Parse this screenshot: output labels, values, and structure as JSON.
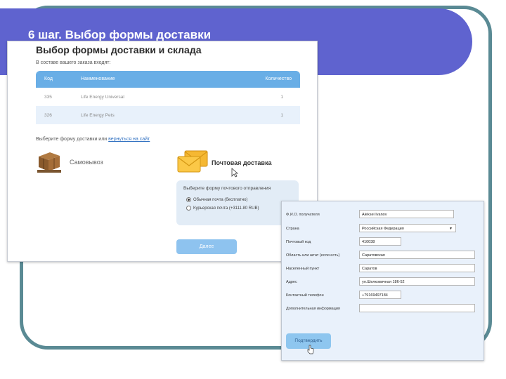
{
  "slide": {
    "title": "6 шаг. Выбор формы доставки",
    "colors": {
      "header": "#5f63cf",
      "frame": "#5a8a94"
    }
  },
  "shipping_page": {
    "title": "Выбор формы доставки и склада",
    "order_note": "В составе вашего заказа входят:",
    "table": {
      "columns": [
        "Код",
        "Наименование",
        "Количество"
      ],
      "rows": [
        {
          "code": "335",
          "name": "Life Energy Universal",
          "qty": "1"
        },
        {
          "code": "326",
          "name": "Life Energy Pets",
          "qty": "1"
        }
      ]
    },
    "choose_text": "Выберите форму доставки или",
    "choose_link": "вернуться на сайт",
    "options": {
      "pickup": {
        "label": "Самовывоз",
        "icon": "box-icon"
      },
      "post": {
        "label": "Почтовая доставка",
        "icon": "envelope-icon"
      }
    },
    "post_panel": {
      "title": "Выберите форму почтового отправления",
      "options": [
        {
          "label": "Обычная почта (бесплатно)",
          "selected": true
        },
        {
          "label": "Курьерская почта (+3111.80 RUB)",
          "selected": false
        }
      ]
    },
    "next_button": "Далее"
  },
  "address_form": {
    "fields": [
      {
        "label": "Ф.И.О. получателя",
        "value": "Aleksei Ivanov"
      },
      {
        "label": "Страна",
        "value": "Российская Федерация",
        "type": "select"
      },
      {
        "label": "Почтовый код",
        "value": "410038"
      },
      {
        "label": "Область или штат (если есть)",
        "value": "Саратовская"
      },
      {
        "label": "Населенный пункт",
        "value": "Саратов"
      },
      {
        "label": "Адрес",
        "value": "ул.Шелковичная 186-52"
      },
      {
        "label": "Контактный телефон",
        "value": "+79169497184"
      },
      {
        "label": "Дополнительная информация",
        "value": ""
      }
    ],
    "submit_button": "Подтвердить"
  }
}
